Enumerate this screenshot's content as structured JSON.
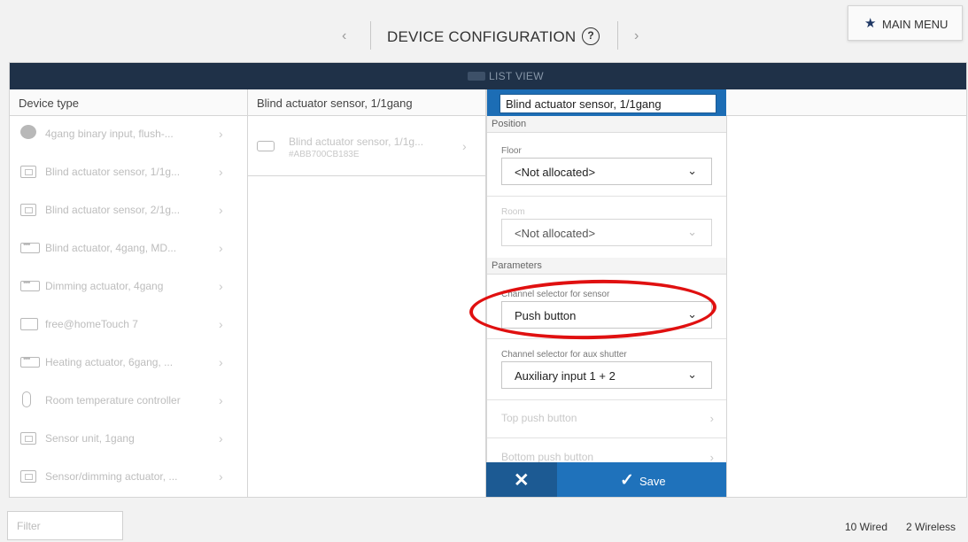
{
  "header": {
    "prev_glyph": "‹",
    "next_glyph": "›",
    "title": "DEVICE CONFIGURATION",
    "help_icon_glyph": "?",
    "main_menu_label": "MAIN MENU"
  },
  "list_view": {
    "label": "LIST VIEW"
  },
  "columns": {
    "device_type_header": "Device type",
    "channel_header": "Blind actuator sensor, 1/1gang"
  },
  "device_types": [
    {
      "label": "4gang binary input, flush-...",
      "icon": "binary-input-icon"
    },
    {
      "label": "Blind actuator sensor, 1/1g...",
      "icon": "blind-sensor-icon"
    },
    {
      "label": "Blind actuator sensor, 2/1g...",
      "icon": "blind-sensor-icon"
    },
    {
      "label": "Blind actuator, 4gang, MD...",
      "icon": "actuator-icon"
    },
    {
      "label": "Dimming actuator, 4gang",
      "icon": "actuator-icon"
    },
    {
      "label": "free@homeTouch 7",
      "icon": "touch-panel-icon"
    },
    {
      "label": "Heating actuator, 6gang, ...",
      "icon": "actuator-icon"
    },
    {
      "label": "Room temperature controller",
      "icon": "thermostat-icon"
    },
    {
      "label": "Sensor unit, 1gang",
      "icon": "sensor-icon"
    },
    {
      "label": "Sensor/dimming actuator, ...",
      "icon": "sensor-icon"
    }
  ],
  "channel_item": {
    "label": "Blind actuator sensor, 1/1g...",
    "serial": "#ABB700CB183E",
    "icon": "blind-sensor-icon"
  },
  "form": {
    "name_value": "Blind actuator sensor, 1/1gang",
    "position_section": "Position",
    "floor_label": "Floor",
    "floor_value": "<Not allocated>",
    "room_label": "Room",
    "room_value": "<Not allocated>",
    "parameters_section": "Parameters",
    "channel_selector_label": "Channel selector for sensor",
    "channel_selector_value": "Push button",
    "aux_selector_label": "Channel selector for aux shutter",
    "aux_selector_value": "Auxiliary input 1 + 2",
    "top_push_button": "Top push button",
    "bottom_push_button": "Bottom push button",
    "cancel_glyph": "✕",
    "save_label": "Save"
  },
  "footer": {
    "filter_placeholder": "Filter",
    "wired_count": "10 Wired",
    "wireless_count": "2 Wireless"
  },
  "colors": {
    "list_bar": "#1f3148",
    "accent_blue": "#1f72bb",
    "highlight_red": "#e01010"
  }
}
